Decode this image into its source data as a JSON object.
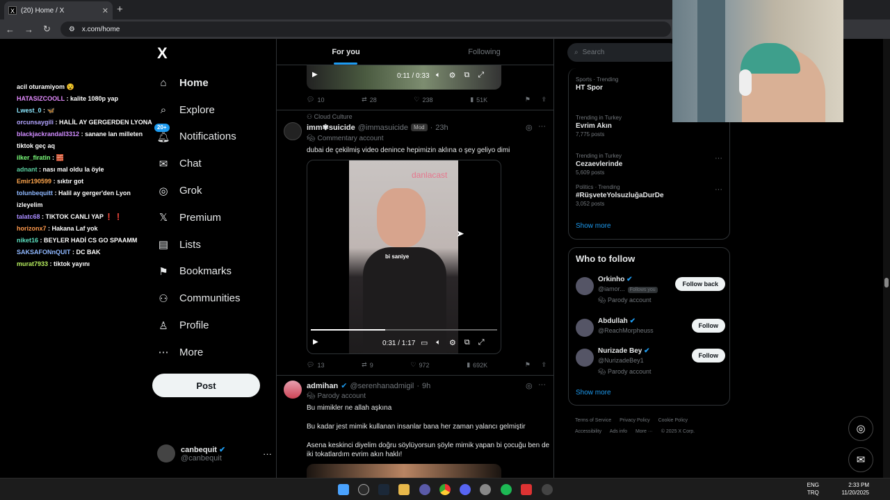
{
  "browser": {
    "tab_title": "(20) Home / X",
    "url": "x.com/home"
  },
  "chat": [
    {
      "user": "",
      "text": "acil oturamiyom 😵",
      "color": "#ffffff"
    },
    {
      "user": "HATASIZCOOLL",
      "text": ": kalite 1080p yap",
      "color": "#e48cff"
    },
    {
      "user": "Lwest_0",
      "text": ": 🦋",
      "color": "#8ce8ff"
    },
    {
      "user": "orcunsaygili",
      "text": ": HALİL AY GERGERDEN LYONA",
      "color": "#b3a4ff"
    },
    {
      "user": "blackjackrandall3312",
      "text": ": sanane lan milleten tiktok geç aq",
      "color": "#d08cff"
    },
    {
      "user": "ilker_firatin",
      "text": ": 🧱",
      "color": "#7cff7c"
    },
    {
      "user": "adnant",
      "text": ": nası mal oldu la öyle",
      "color": "#5cd2a3"
    },
    {
      "user": "Emir190599",
      "text": ": sıktır got",
      "color": "#ffa64d"
    },
    {
      "user": "tolunbequitt",
      "text": ": Halil ay gerger'den Lyon izleyelim",
      "color": "#8fb8ff"
    },
    {
      "user": "talatc68",
      "text": ": TIKTOK CANLI YAP ❗ ❗",
      "color": "#a98cff"
    },
    {
      "user": "horizonx7",
      "text": ": Hakana Laf yok",
      "color": "#ff9a4d"
    },
    {
      "user": "niket16",
      "text": ": BEYLER HADİ CS GO SPAAMM",
      "color": "#5ce0c0"
    },
    {
      "user": "SAKSAFONnQUIT",
      "text": ": DC BAK",
      "color": "#8fb8ff"
    },
    {
      "user": "murat7933",
      "text": ": tiktok yayını",
      "color": "#b8f060"
    }
  ],
  "nav": {
    "logo": "X",
    "items": [
      {
        "label": "Home",
        "icon": "home-icon",
        "glyph": "⌂"
      },
      {
        "label": "Explore",
        "icon": "search-icon",
        "glyph": "⌕"
      },
      {
        "label": "Notifications",
        "icon": "bell-icon",
        "glyph": "🔔︎",
        "badge": "20+"
      },
      {
        "label": "Chat",
        "icon": "mail-icon",
        "glyph": "✉"
      },
      {
        "label": "Grok",
        "icon": "grok-icon",
        "glyph": "◎"
      },
      {
        "label": "Premium",
        "icon": "x-premium-icon",
        "glyph": "𝕏"
      },
      {
        "label": "Lists",
        "icon": "lists-icon",
        "glyph": "▤"
      },
      {
        "label": "Bookmarks",
        "icon": "bookmark-icon",
        "glyph": "⚑"
      },
      {
        "label": "Communities",
        "icon": "communities-icon",
        "glyph": "⚇"
      },
      {
        "label": "Profile",
        "icon": "profile-icon",
        "glyph": "♙"
      },
      {
        "label": "More",
        "icon": "more-icon",
        "glyph": "⋯"
      }
    ],
    "post": "Post",
    "account": {
      "name": "canbequit",
      "handle": "@canbequit"
    }
  },
  "tabs": {
    "for_you": "For you",
    "following": "Following"
  },
  "tweets": {
    "prev": {
      "video_time": "0:11 / 0:33",
      "replies": "10",
      "reposts": "28",
      "likes": "238",
      "views": "51K"
    },
    "t1": {
      "community": "Cloud Culture",
      "name": "imm✾suicide",
      "handle": "@immasuicide",
      "badge": "Mod",
      "time": "23h",
      "label": "Commentary account",
      "text": "dubai de çekilmiş video denince hepimizin aklına o şey geliyo dimi",
      "video_brand": "danlacast",
      "video_caption": "bi saniye",
      "video_time": "0:31 / 1:17",
      "video_progress": 0.4,
      "replies": "13",
      "reposts": "9",
      "likes": "972",
      "views": "692K"
    },
    "t2": {
      "name": "admihan",
      "handle": "@serenhanadmigil",
      "time": "9h",
      "label": "Parody account",
      "line1": "Bu mimikler ne allah aşkına",
      "line2": "Bu kadar jest mimik kullanan insanlar bana her zaman yalancı gelmiştir",
      "line3": "Asena keskinci diyelim doğru söylüyorsun şöyle mimik yapan bi çocuğu ben de iki tokatlardım evrim akın haklı!"
    }
  },
  "search": {
    "placeholder": "Search"
  },
  "trends": [
    {
      "meta": "Sports · Trending",
      "title": "HT Spor",
      "count": ""
    },
    {
      "meta": "Trending in Turkey",
      "title": "Evrim Akın",
      "count": "7,775 posts"
    },
    {
      "meta": "Trending in Turkey",
      "title": "Cezaevlerinde",
      "count": "5,609 posts"
    },
    {
      "meta": "Politics · Trending",
      "title": "#RüşveteYolsuzluğaDurDe",
      "count": "3,052 posts"
    }
  ],
  "trends_show_more": "Show more",
  "who_to_follow": {
    "title": "Who to follow",
    "items": [
      {
        "name": "Orkinho",
        "handle": "@iamor...",
        "follows_you": "Follows you",
        "label": "Parody account",
        "button": "Follow back"
      },
      {
        "name": "Abdullah",
        "handle": "@ReachMorpheuss",
        "label": "",
        "button": "Follow"
      },
      {
        "name": "Nurizade Bey",
        "handle": "@NurizadeBey1",
        "label": "Parody account",
        "button": "Follow"
      }
    ],
    "show_more": "Show more"
  },
  "footer": {
    "terms": "Terms of Service",
    "privacy": "Privacy Policy",
    "cookie": "Cookie Policy",
    "accessibility": "Accessibility",
    "ads": "Ads info",
    "more": "More ···",
    "copyright": "© 2025 X Corp."
  },
  "taskbar": {
    "lang1": "ENG",
    "lang2": "TRQ",
    "time": "2:33 PM",
    "date": "11/20/2025"
  },
  "colors": {
    "accent": "#1d9bf0",
    "bg": "#000000",
    "border": "#2f3336"
  }
}
